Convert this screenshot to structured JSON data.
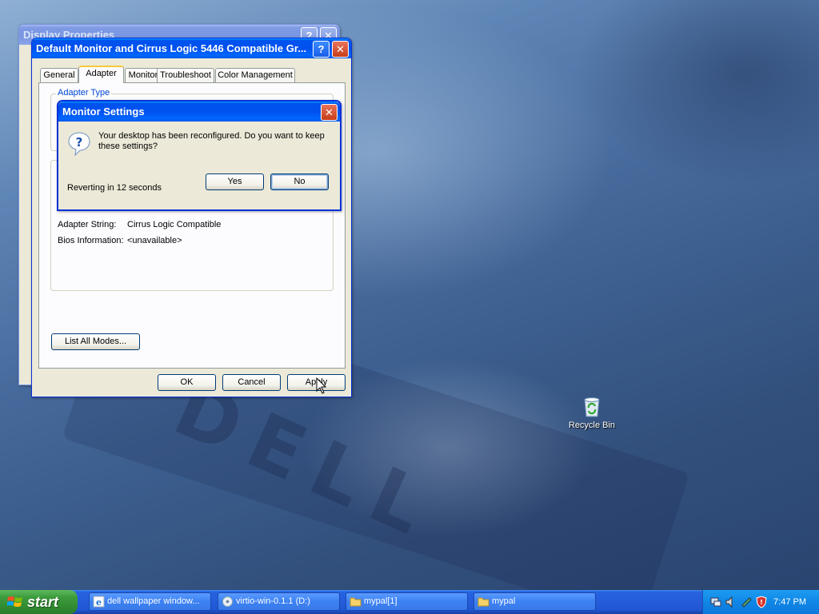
{
  "desktop": {
    "recycle_bin_label": "Recycle Bin",
    "wallpaper_text": "DELL"
  },
  "display_properties": {
    "title": "Display Properties"
  },
  "adapter_props": {
    "title": "Default Monitor and Cirrus Logic 5446 Compatible Gr...",
    "help_glyph": "?",
    "close_glyph": "✕",
    "tabs": [
      "General",
      "Adapter",
      "Monitor",
      "Troubleshoot",
      "Color Management"
    ],
    "active_tab": "Adapter",
    "adapter_type_label": "Adapter Type",
    "adapter_string_label": "Adapter String:",
    "adapter_string_value": "Cirrus Logic Compatible",
    "bios_label": "Bios Information:",
    "bios_value": "<unavailable>",
    "list_all_modes": "List All Modes...",
    "ok": "OK",
    "cancel": "Cancel",
    "apply": "Apply"
  },
  "monitor_dialog": {
    "title": "Monitor Settings",
    "close_glyph": "✕",
    "message": "Your desktop has been reconfigured.  Do you want to keep these settings?",
    "countdown": "Reverting in 12 seconds",
    "yes": "Yes",
    "no": "No"
  },
  "taskbar": {
    "start_label": "start",
    "buttons": [
      {
        "label": "dell wallpaper window...",
        "icon": "internet-explorer-icon"
      },
      {
        "label": "virtio-win-0.1.1 (D:)",
        "icon": "cd-drive-icon"
      },
      {
        "label": "mypal[1]",
        "icon": "folder-icon"
      },
      {
        "label": "mypal",
        "icon": "folder-icon"
      }
    ],
    "clock": "7:47 PM"
  },
  "colors": {
    "xp_title_blue": "#0054e3",
    "taskbar_blue": "#245edb",
    "start_green": "#3c9c3c",
    "window_face": "#ece9d8"
  }
}
